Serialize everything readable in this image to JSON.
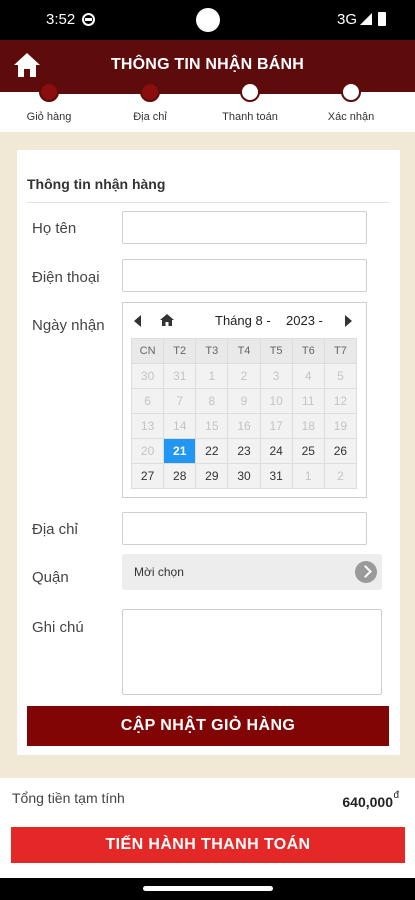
{
  "status_bar": {
    "time": "3:52",
    "network": "3G"
  },
  "header": {
    "title": "THÔNG TIN NHẬN BÁNH"
  },
  "steps": [
    {
      "label": "Giỏ hàng",
      "done": true
    },
    {
      "label": "Địa chỉ",
      "done": true
    },
    {
      "label": "Thanh toán",
      "done": false
    },
    {
      "label": "Xác nhận",
      "done": false
    }
  ],
  "form": {
    "title": "Thông tin nhận hàng",
    "name_label": "Họ tên",
    "name_value": "",
    "phone_label": "Điện thoại",
    "phone_value": "",
    "date_label": "Ngày nhận",
    "address_label": "Địa chỉ",
    "address_value": "",
    "district_label": "Quận",
    "district_value": "Mời chọn",
    "note_label": "Ghi chú",
    "note_value": "",
    "update_button": "CẬP NHẬT GIỎ HÀNG"
  },
  "calendar": {
    "month_label": "Tháng 8 -",
    "year_label": "2023 -",
    "weekdays": [
      "CN",
      "T2",
      "T3",
      "T4",
      "T5",
      "T6",
      "T7"
    ],
    "weeks": [
      [
        {
          "d": "30",
          "m": true
        },
        {
          "d": "31",
          "m": true
        },
        {
          "d": "1",
          "m": true
        },
        {
          "d": "2",
          "m": true
        },
        {
          "d": "3",
          "m": true
        },
        {
          "d": "4",
          "m": true
        },
        {
          "d": "5",
          "m": true
        }
      ],
      [
        {
          "d": "6",
          "m": true
        },
        {
          "d": "7",
          "m": true
        },
        {
          "d": "8",
          "m": true
        },
        {
          "d": "9",
          "m": true
        },
        {
          "d": "10",
          "m": true
        },
        {
          "d": "11",
          "m": true
        },
        {
          "d": "12",
          "m": true
        }
      ],
      [
        {
          "d": "13",
          "m": true
        },
        {
          "d": "14",
          "m": true
        },
        {
          "d": "15",
          "m": true
        },
        {
          "d": "16",
          "m": true
        },
        {
          "d": "17",
          "m": true
        },
        {
          "d": "18",
          "m": true
        },
        {
          "d": "19",
          "m": true
        }
      ],
      [
        {
          "d": "20",
          "m": true
        },
        {
          "d": "21",
          "sel": true
        },
        {
          "d": "22"
        },
        {
          "d": "23"
        },
        {
          "d": "24"
        },
        {
          "d": "25"
        },
        {
          "d": "26"
        }
      ],
      [
        {
          "d": "27"
        },
        {
          "d": "28"
        },
        {
          "d": "29"
        },
        {
          "d": "30"
        },
        {
          "d": "31"
        },
        {
          "d": "1",
          "m": true
        },
        {
          "d": "2",
          "m": true
        }
      ]
    ]
  },
  "footer": {
    "total_label": "Tổng tiền tạm tính",
    "total_value": "640,000",
    "currency": "đ",
    "checkout_button": "TIẾN HÀNH THANH TOÁN"
  },
  "colors": {
    "primary": "#5e0b0b",
    "accent": "#e42828",
    "selected_day": "#2196f3"
  }
}
